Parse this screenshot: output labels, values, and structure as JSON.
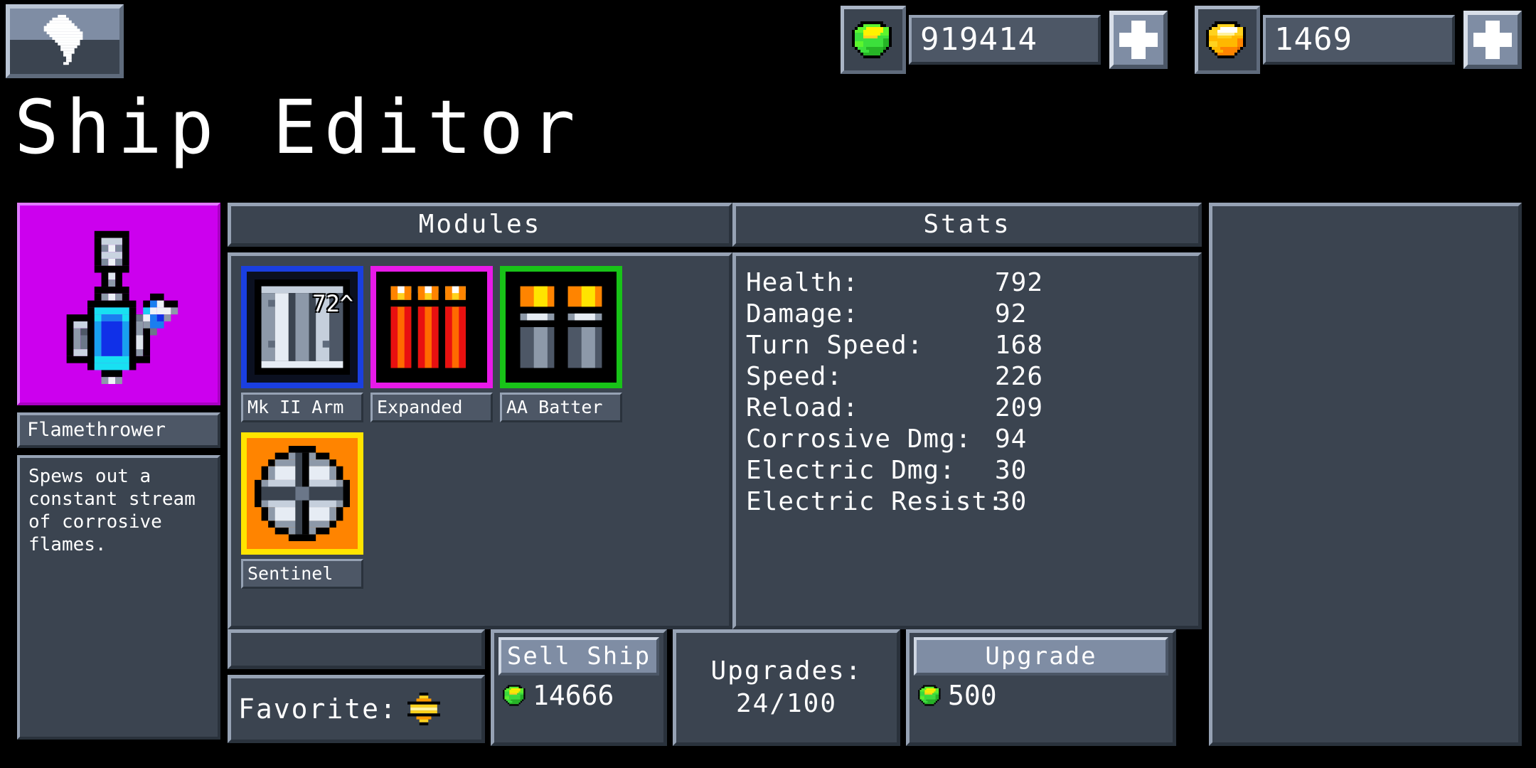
{
  "header": {
    "back_icon": "back-arrow-icon",
    "money": {
      "icon": "cash-stack-icon",
      "value": "919414",
      "add_label": "+"
    },
    "gold": {
      "icon": "gold-bar-icon",
      "value": "1469",
      "add_label": "+"
    }
  },
  "page_title": "Ship Editor",
  "ship": {
    "icon": "flamethrower-icon",
    "name": "Flamethrower",
    "description": "Spews out a\nconstant stream\nof corrosive\nflames.",
    "preview_bg": "#cc00ee"
  },
  "modules": {
    "header": "Modules",
    "items": [
      {
        "label": "Mk II Arm",
        "count": "72^",
        "border": "#1a3fe0",
        "icon": "armor-plate-icon",
        "bg": "#0b1020"
      },
      {
        "label": "Expanded",
        "count": "",
        "border": "#e81ae8",
        "icon": "fuel-tank-icon",
        "bg": "#000000"
      },
      {
        "label": "AA Batter",
        "count": "",
        "border": "#18c318",
        "icon": "aa-battery-icon",
        "bg": "#000000"
      },
      {
        "label": "Sentinel",
        "count": "",
        "border": "#ffe400",
        "icon": "sentinel-orb-icon",
        "bg": "#ff8400"
      }
    ]
  },
  "stats": {
    "header": "Stats",
    "rows": [
      {
        "label": "Health:",
        "value": "792"
      },
      {
        "label": "Damage:",
        "value": "92"
      },
      {
        "label": "Turn Speed:",
        "value": "168"
      },
      {
        "label": "Speed:",
        "value": "226"
      },
      {
        "label": "Reload:",
        "value": "209"
      },
      {
        "label": "Corrosive Dmg:",
        "value": "94"
      },
      {
        "label": "Electric Dmg:",
        "value": "30"
      },
      {
        "label": "Electric Resist:",
        "value": "30"
      }
    ]
  },
  "actions": {
    "favorite_label": "Favorite:",
    "favorite_icon": "star-coin-icon",
    "sell_label": "Sell Ship",
    "sell_price": "14666",
    "upgrades_label": "Upgrades:",
    "upgrades_value": "24/100",
    "upgrade_label": "Upgrade",
    "upgrade_price": "500"
  },
  "colors": {
    "panel_bg": "#3b4450",
    "panel_light": "#96a2b4",
    "panel_dark": "#2a323c",
    "text": "#ffffff",
    "money_green": "#3ce03c",
    "gold_yellow": "#ffd21e"
  }
}
